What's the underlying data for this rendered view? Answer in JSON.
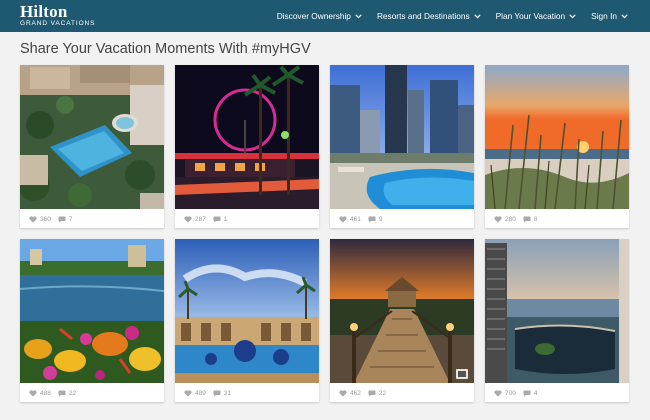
{
  "brand": {
    "name": "Hilton",
    "sub": "GRAND VACATIONS"
  },
  "nav": [
    {
      "label": "Discover Ownership"
    },
    {
      "label": "Resorts and Destinations"
    },
    {
      "label": "Plan Your Vacation"
    },
    {
      "label": "Sign In"
    }
  ],
  "heading": "Share Your Vacation Moments With #myHGV",
  "posts": [
    {
      "likes": "360",
      "comments": "7",
      "scene": "aerial-pool"
    },
    {
      "likes": "287",
      "comments": "1",
      "scene": "ferris-wheel-night"
    },
    {
      "likes": "461",
      "comments": "9",
      "scene": "city-pool"
    },
    {
      "likes": "280",
      "comments": "8",
      "scene": "beach-sunset"
    },
    {
      "likes": "488",
      "comments": "22",
      "scene": "lake-flowers"
    },
    {
      "likes": "489",
      "comments": "31",
      "scene": "fountain-courtyard"
    },
    {
      "likes": "462",
      "comments": "22",
      "scene": "boardwalk-gazebo"
    },
    {
      "likes": "700",
      "comments": "4",
      "scene": "ocean-pool-tower"
    }
  ],
  "icons": {
    "like": "heart-icon",
    "comment": "comment-icon",
    "chevron": "chevron-down-icon"
  },
  "colors": {
    "nav_bg": "#1f5871",
    "page_bg": "#f2f2f2",
    "meta_text": "#999999"
  }
}
